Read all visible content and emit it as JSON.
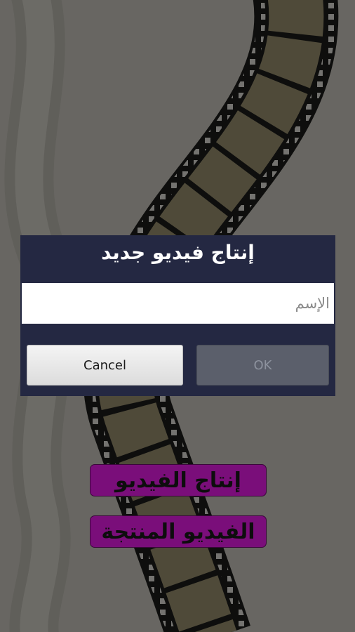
{
  "screen": {
    "buttons": {
      "create_video": "إنتاج الفيديو",
      "produced_videos": "الفيديو المنتجة"
    }
  },
  "dialog": {
    "title": "إنتاج فيديو جديد",
    "name_placeholder": "الإسم",
    "name_value": "",
    "cancel_label": "Cancel",
    "ok_label": "OK",
    "ok_enabled": false
  },
  "colors": {
    "dialog_bg": "#242842",
    "button_purple": "#7a0e7a",
    "overlay": "rgba(0,0,0,0.52)"
  },
  "icons": {
    "background": "film-strip-art"
  }
}
